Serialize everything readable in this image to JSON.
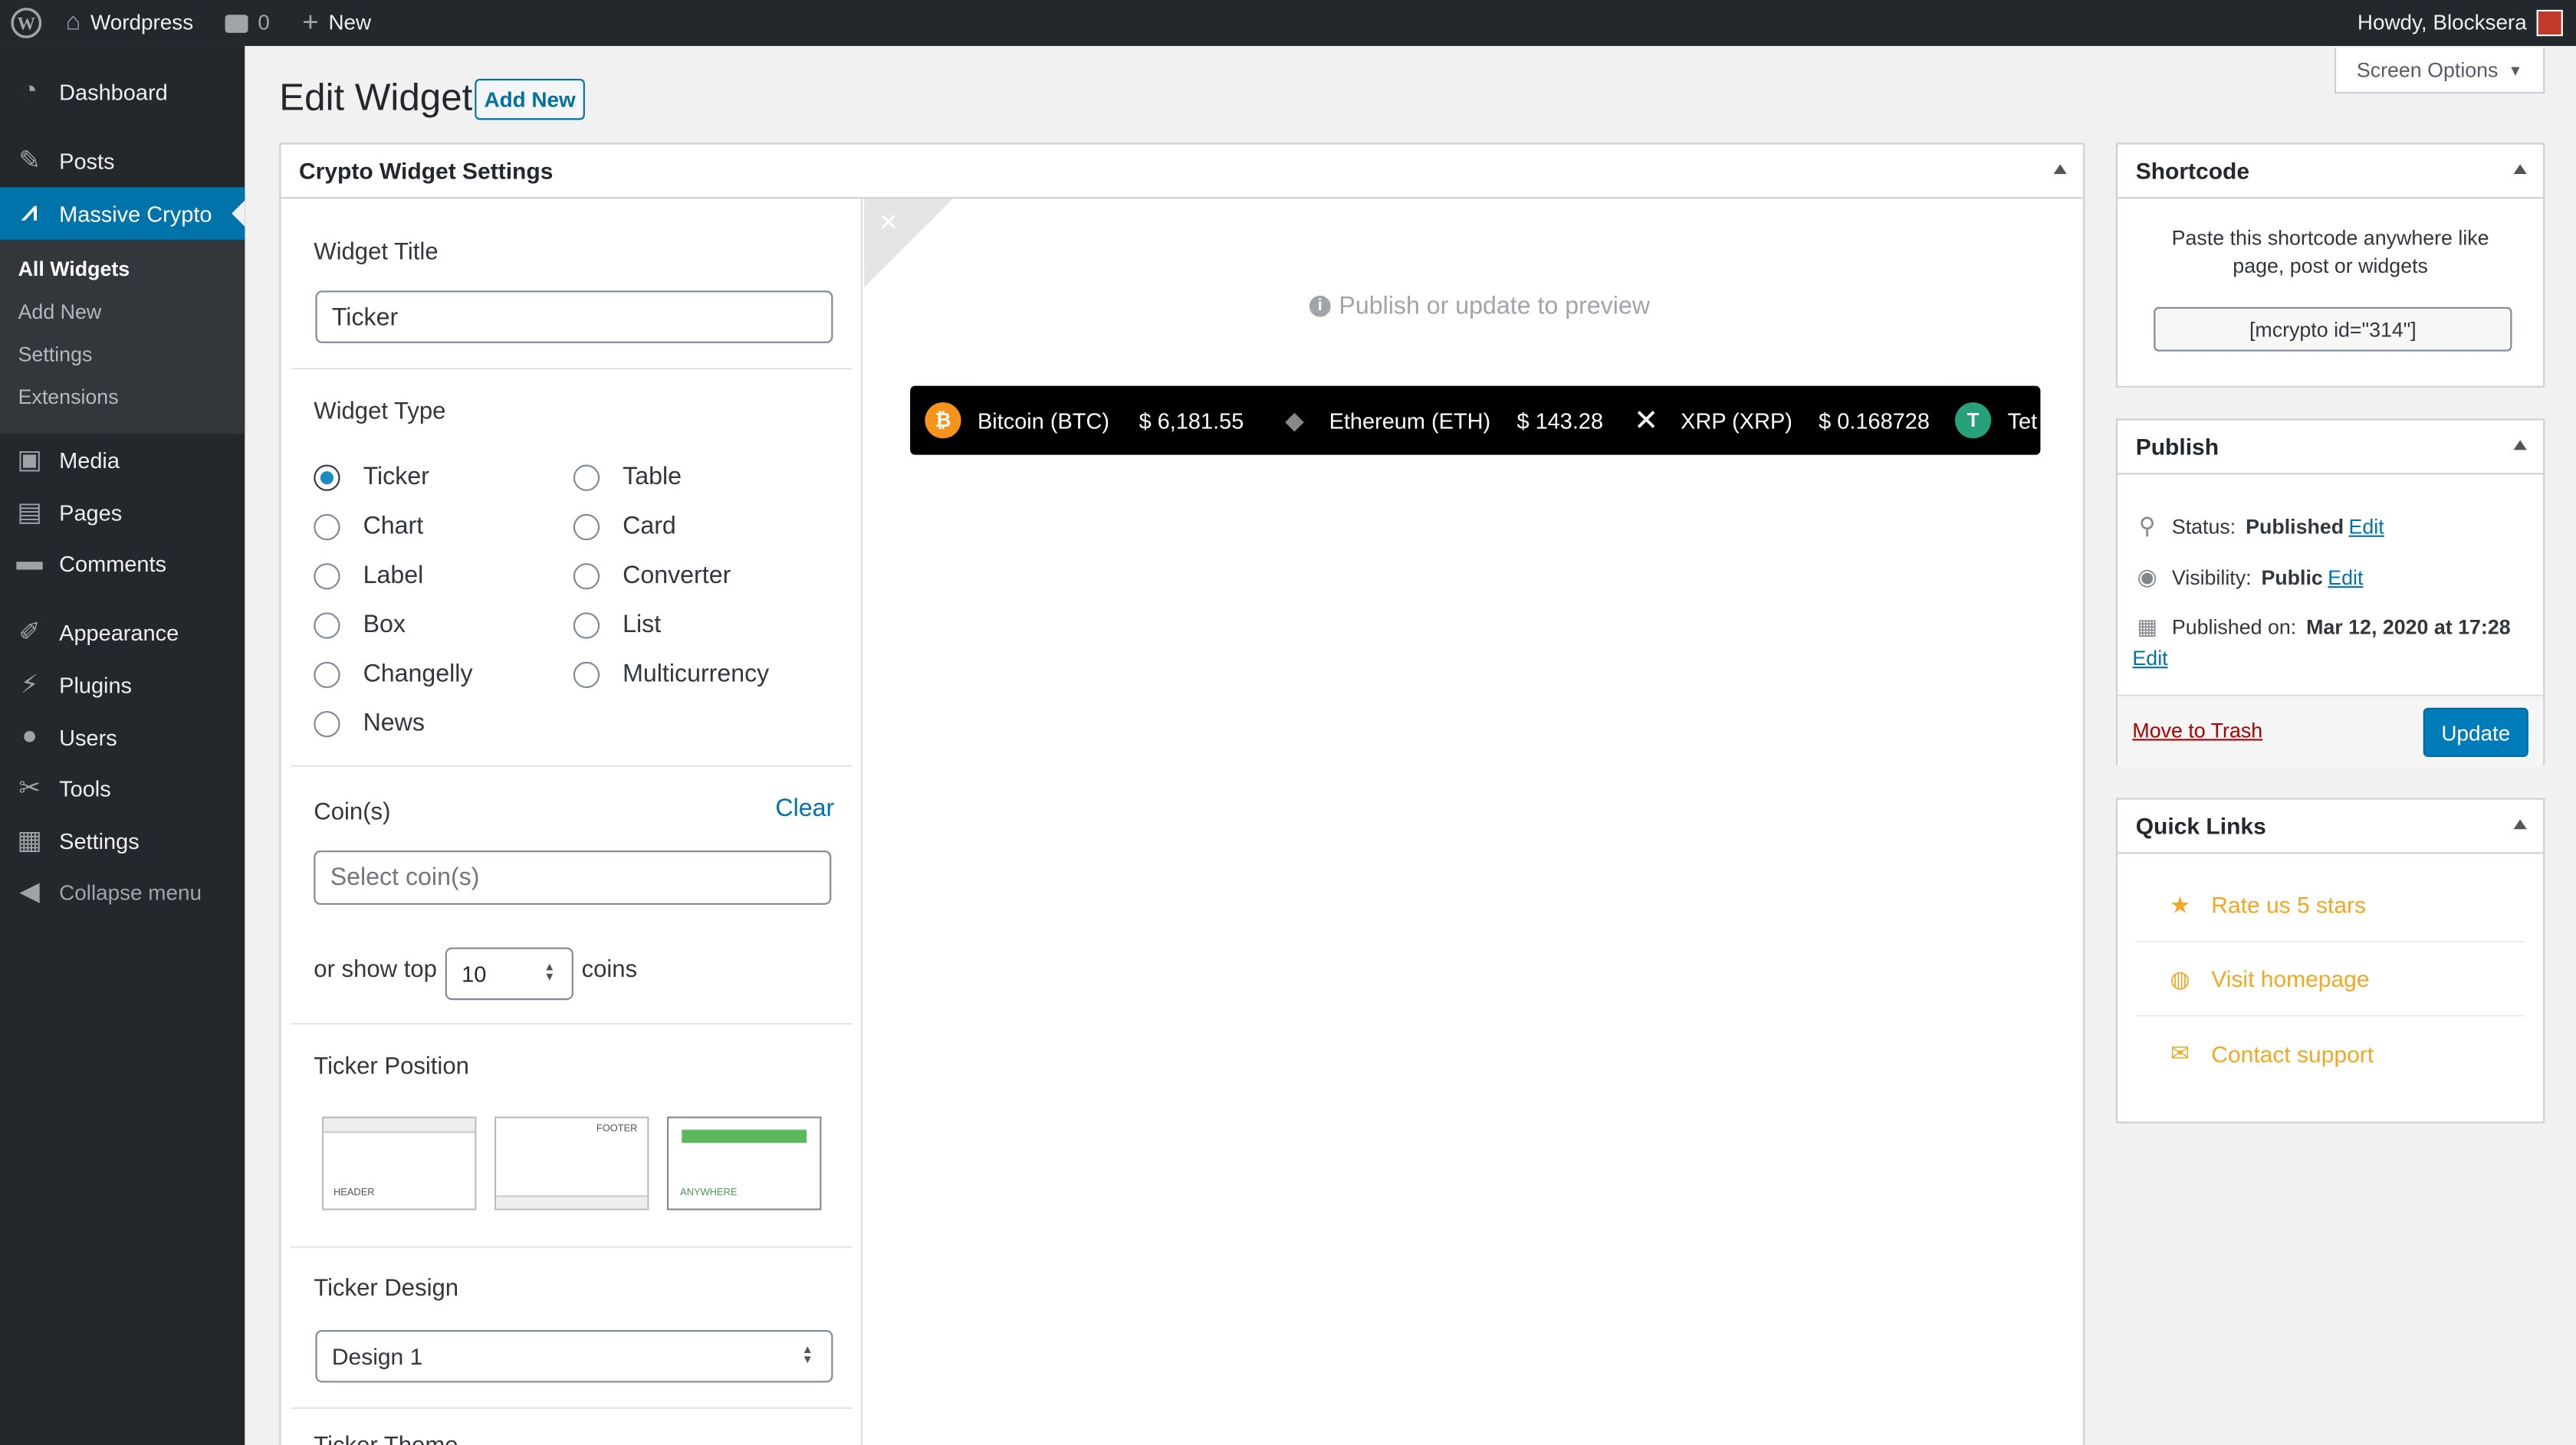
{
  "adminbar": {
    "site_name": "Wordpress",
    "comments_count": "0",
    "new_label": "New",
    "howdy": "Howdy, Blocksera"
  },
  "sidebar": {
    "items": [
      {
        "label": "Dashboard",
        "icon": "dashboard-icon"
      },
      {
        "label": "Posts",
        "icon": "pin-icon"
      },
      {
        "label": "Massive Crypto",
        "icon": "massive-crypto-icon"
      },
      {
        "label": "Media",
        "icon": "media-icon"
      },
      {
        "label": "Pages",
        "icon": "pages-icon"
      },
      {
        "label": "Comments",
        "icon": "comments-icon"
      },
      {
        "label": "Appearance",
        "icon": "appearance-icon"
      },
      {
        "label": "Plugins",
        "icon": "plugins-icon"
      },
      {
        "label": "Users",
        "icon": "users-icon"
      },
      {
        "label": "Tools",
        "icon": "tools-icon"
      },
      {
        "label": "Settings",
        "icon": "settings-icon"
      }
    ],
    "submenu": [
      "All Widgets",
      "Add New",
      "Settings",
      "Extensions"
    ],
    "collapse_label": "Collapse menu"
  },
  "page": {
    "title": "Edit Widget",
    "add_new": "Add New",
    "screen_options": "Screen Options"
  },
  "settings": {
    "box_title": "Crypto Widget Settings",
    "widget_title_label": "Widget Title",
    "widget_title_value": "Ticker",
    "widget_type_label": "Widget Type",
    "types_left": [
      "Ticker",
      "Chart",
      "Label",
      "Box",
      "Changelly",
      "News"
    ],
    "types_right": [
      "Table",
      "Card",
      "Converter",
      "List",
      "Multicurrency"
    ],
    "selected_type": "Ticker",
    "coins_label": "Coin(s)",
    "clear_label": "Clear",
    "coins_placeholder": "Select coin(s)",
    "show_top_prefix": "or show top",
    "show_top_value": "10",
    "show_top_suffix": "coins",
    "ticker_position_label": "Ticker Position",
    "positions": [
      "HEADER",
      "FOOTER",
      "ANYWHERE"
    ],
    "selected_position": "ANYWHERE",
    "ticker_design_label": "Ticker Design",
    "ticker_design_value": "Design 1",
    "next_label": "Ticker Theme"
  },
  "preview": {
    "message": "Publish or update to preview",
    "ticker": [
      {
        "name": "Bitcoin (BTC)",
        "price": "$ 6,181.55",
        "icon": "bitcoin-icon",
        "color": "#f7931a"
      },
      {
        "name": "Ethereum (ETH)",
        "price": "$ 143.28",
        "icon": "ethereum-icon",
        "color": "#627eea"
      },
      {
        "name": "XRP (XRP)",
        "price": "$ 0.168728",
        "icon": "xrp-icon",
        "color": "#ffffff"
      },
      {
        "name": "Tet",
        "price": "",
        "icon": "tether-icon",
        "color": "#26a17b"
      }
    ]
  },
  "shortcode": {
    "title": "Shortcode",
    "description_line1": "Paste this shortcode anywhere like",
    "description_line2": "page, post or widgets",
    "code": "[mcrypto id=\"314\"]"
  },
  "publish": {
    "title": "Publish",
    "status_label": "Status:",
    "status_value": "Published",
    "visibility_label": "Visibility:",
    "visibility_value": "Public",
    "published_label": "Published on:",
    "published_value": "Mar 12, 2020 at 17:28",
    "edit": "Edit",
    "trash": "Move to Trash",
    "update": "Update"
  },
  "quick_links": {
    "title": "Quick Links",
    "items": [
      {
        "label": "Rate us 5 stars",
        "icon": "star-icon"
      },
      {
        "label": "Visit homepage",
        "icon": "globe-icon"
      },
      {
        "label": "Contact support",
        "icon": "envelope-icon"
      }
    ]
  },
  "colors": {
    "admin_dark": "#23282d",
    "accent": "#0073aa",
    "orange": "#f5a623",
    "trash": "#aa0000"
  }
}
